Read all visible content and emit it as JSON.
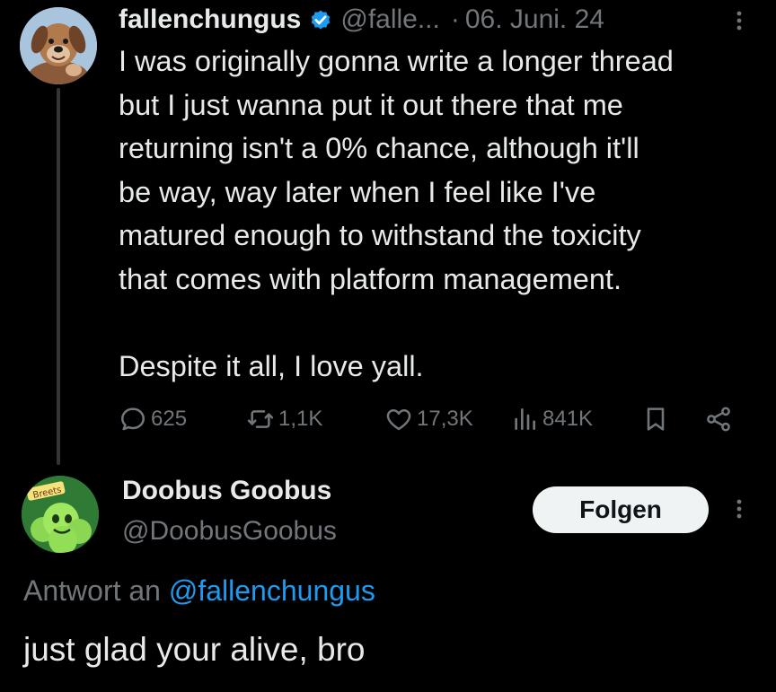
{
  "tweet": {
    "display_name": "fallenchungus",
    "handle": "@falle...",
    "separator": "·",
    "date": "06. Juni. 24",
    "body": "I was originally gonna write a longer thread\nbut I just wanna put it out there that me\nreturning isn't a 0% chance, although it'll\nbe way, way later when I feel like I've\nmatured enough to withstand the toxicity\nthat comes with platform management.\n\nDespite it all, I love yall.",
    "stats": {
      "replies": "625",
      "reposts": "1,1K",
      "likes": "17,3K",
      "views": "841K"
    }
  },
  "reply": {
    "display_name": "Doobus Goobus",
    "handle": "@DoobusGoobus",
    "follow_label": "Folgen",
    "avatar_text": "Breets",
    "reply_to_prefix": "Antwort an",
    "reply_to_handle": "@fallenchungus",
    "body": "just glad your alive, bro"
  },
  "colors": {
    "background": "#000000",
    "text": "#e7e9ea",
    "muted": "#71767b",
    "accent": "#1d9bf0"
  },
  "icons": [
    "verified-badge-icon",
    "more-icon",
    "reply-icon",
    "repost-icon",
    "like-icon",
    "views-icon",
    "bookmark-icon",
    "share-icon"
  ]
}
